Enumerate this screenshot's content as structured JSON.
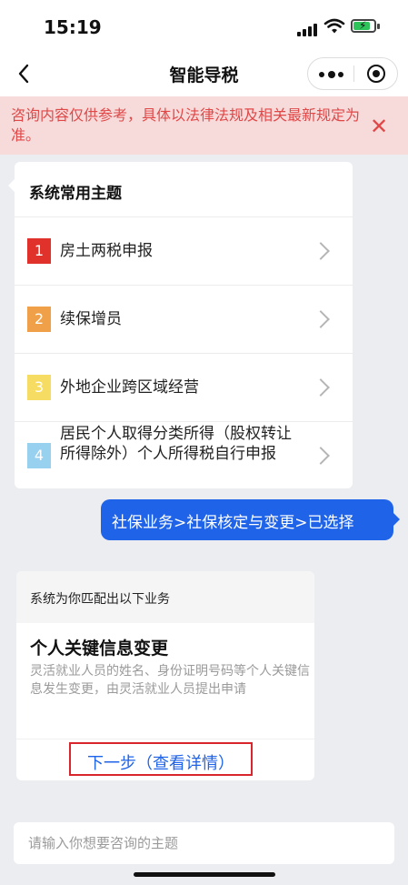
{
  "status_bar": {
    "time": "15:19"
  },
  "nav": {
    "title": "智能导税"
  },
  "notice": {
    "text": "咨询内容仅供参考，具体以法律法规及相关最新规定为准。",
    "close_glyph": "✕"
  },
  "topics": {
    "title": "系统常用主题",
    "items": [
      {
        "num": "1",
        "label": "房土两税申报",
        "color": "#e0322b"
      },
      {
        "num": "2",
        "label": "续保增员",
        "color": "#f0a048"
      },
      {
        "num": "3",
        "label": "外地企业跨区域经营",
        "color": "#f7dc63"
      },
      {
        "num": "4",
        "label": "居民个人取得分类所得（股权转让所得除外）个人所得税自行申报",
        "color": "#98d0ef"
      }
    ]
  },
  "user_message": "社保业务>社保核定与变更>已选择",
  "business": {
    "header": "系统为你匹配出以下业务",
    "title": "个人关键信息变更",
    "description": "灵活就业人员的姓名、身份证明号码等个人关键信息发生变更，由灵活就业人员提出申请",
    "next_label": "下一步（查看详情）"
  },
  "input": {
    "placeholder": "请输入你想要咨询的主题"
  },
  "colors": {
    "accent": "#1f63e8",
    "notice_bg": "#f7dada",
    "notice_text": "#e04848"
  }
}
